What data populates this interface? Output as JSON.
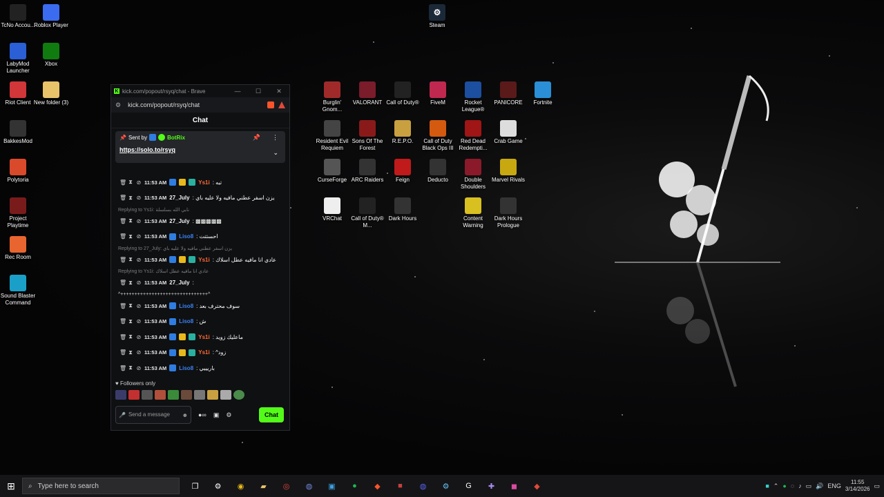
{
  "desktop": {
    "left_icons": [
      {
        "label": "TcNo Accou...",
        "color": "#222"
      },
      {
        "label": "Roblox Player",
        "color": "#3b6cf0"
      },
      {
        "label": "LabyMod Launcher",
        "color": "#2a5fd6"
      },
      {
        "label": "Xbox",
        "color": "#107c10"
      },
      {
        "label": "Riot Client",
        "color": "#d13639"
      },
      {
        "label": "New folder (3)",
        "color": "#e8c36a"
      },
      {
        "label": "BakkesMod",
        "color": "#333"
      },
      {
        "label": "Polytoria",
        "color": "#d94a2b"
      },
      {
        "label": "Project Playtime",
        "color": "#7a1b1b"
      },
      {
        "label": "Rec Room",
        "color": "#e8652f"
      },
      {
        "label": "Sound Blaster Command",
        "color": "#1aa0c8"
      }
    ],
    "top_icon": {
      "label": "Steam",
      "color": "#1b2838"
    },
    "grid_icons": [
      {
        "label": "Burglin' Gnom...",
        "color": "#a02a2a"
      },
      {
        "label": "VALORANT",
        "color": "#7a1c2a"
      },
      {
        "label": "Call of Duty®",
        "color": "#222"
      },
      {
        "label": "FiveM",
        "color": "#c0284f"
      },
      {
        "label": "Rocket League®",
        "color": "#1c4fa0"
      },
      {
        "label": "PANICORE",
        "color": "#5a1a1a"
      },
      {
        "label": "Fortnite",
        "color": "#2a8fd6"
      },
      {
        "label": "Resident Evil Requiem",
        "color": "#444"
      },
      {
        "label": "Sons Of The Forest",
        "color": "#8a1a1a"
      },
      {
        "label": "R.E.P.O.",
        "color": "#c8a040"
      },
      {
        "label": "Call of Duty Black Ops III",
        "color": "#d45a10"
      },
      {
        "label": "Red Dead Redempti...",
        "color": "#a01515"
      },
      {
        "label": "Crab Game",
        "color": "#ddd"
      },
      {
        "label": "CurseForge",
        "color": "#555"
      },
      {
        "label": "ARC Raiders",
        "color": "#333"
      },
      {
        "label": "Feign",
        "color": "#c01a1a"
      },
      {
        "label": "Deducto",
        "color": "#333"
      },
      {
        "label": "Double Shoulders",
        "color": "#8a1a2a"
      },
      {
        "label": "Marvel Rivals",
        "color": "#c8a810"
      },
      {
        "label": "VRChat",
        "color": "#eee"
      },
      {
        "label": "Call of Duty® M...",
        "color": "#222"
      },
      {
        "label": "Dark Hours",
        "color": "#333"
      },
      {
        "label": "Content Warning",
        "color": "#d8c020"
      },
      {
        "label": "Dark Hours Prologue",
        "color": "#333"
      }
    ]
  },
  "browser": {
    "title": "kick.com/popout/rsyq/chat - Brave",
    "url": "kick.com/popout/rsyq/chat",
    "minimize": "—",
    "maximize": "☐",
    "close": "✕"
  },
  "chat": {
    "header": "Chat",
    "pinned": {
      "sent_by": "Sent by",
      "author": "BotRix",
      "link": "https://solo.to/rsyq"
    },
    "entries": [
      {
        "type": "msg",
        "time": "11:53 AM",
        "user": "Ys1i",
        "ucls": "u-ys",
        "text": ": تبه"
      },
      {
        "type": "msg",
        "time": "11:53 AM",
        "user": "27_July",
        "ucls": "u-july",
        "text": ": يزن اسفر عطني مافيه ولا عليه باي"
      },
      {
        "type": "reply",
        "text": "Replying to Ys1i: نابي الله بسلسلة"
      },
      {
        "type": "msg",
        "time": "11:53 AM",
        "user": "27_July",
        "ucls": "u-july",
        "text": ": ▩▩▩▩▩"
      },
      {
        "type": "msg",
        "time": "11:53 AM",
        "user": "Liso8",
        "ucls": "u-liso",
        "text": ": احستتت"
      },
      {
        "type": "reply",
        "text": "Replying to 27_July: يزن اسفر عطني مافيه ولا عليه باي"
      },
      {
        "type": "msg",
        "time": "11:53 AM",
        "user": "Ys1i",
        "ucls": "u-ys",
        "text": ": عادي انا مافيه عطل اسلاك"
      },
      {
        "type": "reply",
        "text": "Replying to Ys1i: عادي انا مافيه عطل اسلاك"
      },
      {
        "type": "msg",
        "time": "11:53 AM",
        "user": "27_July",
        "ucls": "u-july",
        "text": ":"
      },
      {
        "type": "line",
        "text": "^+++++++++++++++++++++++++++++++^"
      },
      {
        "type": "msg",
        "time": "11:53 AM",
        "user": "Liso8",
        "ucls": "u-liso",
        "text": ": سوف محترف بعد"
      },
      {
        "type": "msg",
        "time": "11:53 AM",
        "user": "Liso8",
        "ucls": "u-liso",
        "text": ": ش"
      },
      {
        "type": "msg",
        "time": "11:53 AM",
        "user": "Ys1i",
        "ucls": "u-ys",
        "text": ": ماعليك زويد"
      },
      {
        "type": "msg",
        "time": "11:53 AM",
        "user": "Ys1i",
        "ucls": "u-ys",
        "text": ": ^زود"
      },
      {
        "type": "msg",
        "time": "11:53 AM",
        "user": "Liso8",
        "ucls": "u-liso",
        "text": ": باريييي"
      }
    ],
    "followers_only": "Followers only",
    "input_placeholder": "Send a message",
    "send_label": "Chat"
  },
  "taskbar": {
    "search_placeholder": "Type here to search",
    "lang": "ENG",
    "time": "11:55",
    "date": "3/14/2026"
  }
}
